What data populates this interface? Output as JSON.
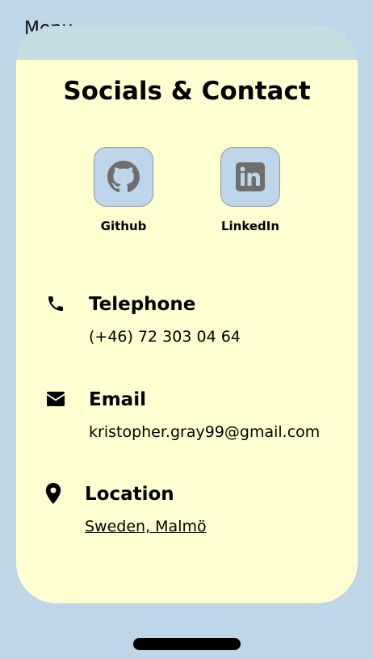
{
  "menu": {
    "label": "Menu"
  },
  "card": {
    "title": "Socials & Contact",
    "top_band_color": "#c4dde0",
    "background_color": "#ffffd1"
  },
  "socials": [
    {
      "name": "Github",
      "icon": "github-icon"
    },
    {
      "name": "LinkedIn",
      "icon": "linkedin-icon"
    }
  ],
  "contact": {
    "telephone": {
      "heading": "Telephone",
      "value": "(+46) 72 303 04 64",
      "icon": "phone-icon"
    },
    "email": {
      "heading": "Email",
      "value": "kristopher.gray99@gmail.com",
      "icon": "envelope-icon"
    },
    "location": {
      "heading": "Location",
      "value": "Sweden, Malmö",
      "icon": "map-pin-icon"
    }
  },
  "colors": {
    "page_background": "#bfd6e8",
    "tile_background": "#bed6ea",
    "icon_gray": "#6e6e6e"
  }
}
